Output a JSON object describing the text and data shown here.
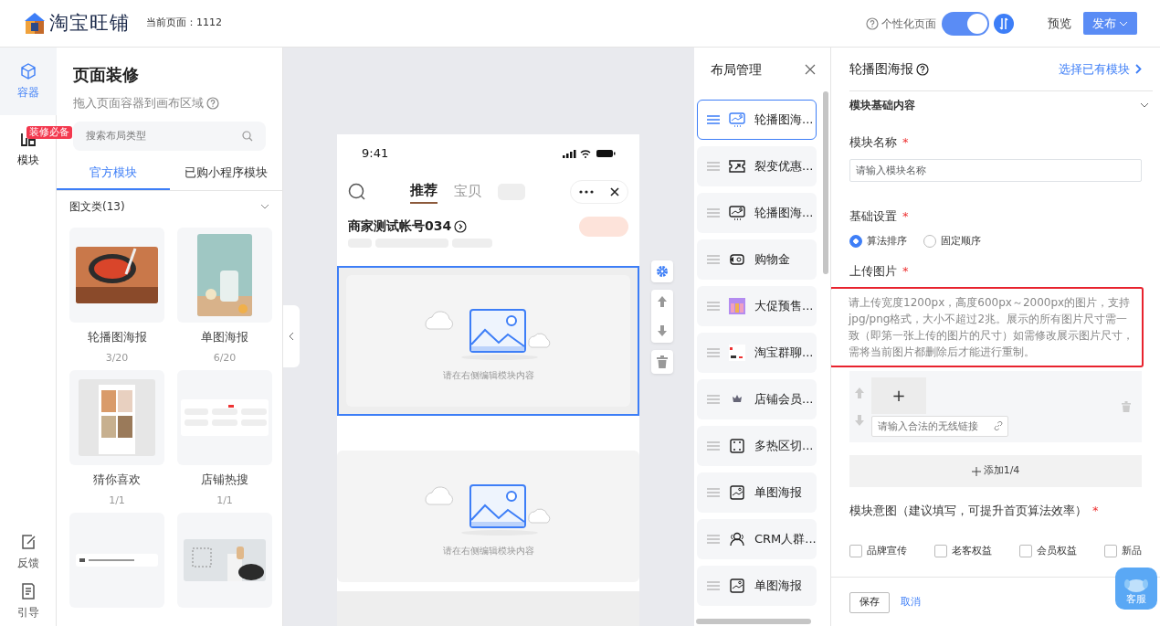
{
  "header": {
    "logo_text": "淘宝旺铺",
    "current_page": "当前页面：1112",
    "personalize_label": "个性化页面",
    "personalize_on": true,
    "preview": "预览",
    "publish": "发布"
  },
  "rail": [
    {
      "label": "容器",
      "kind": "cube",
      "selected": true
    },
    {
      "label": "模块",
      "kind": "blocks",
      "selected": false,
      "badge": "装修必备"
    }
  ],
  "rail_bottom": [
    {
      "label": "反馈",
      "kind": "edit"
    },
    {
      "label": "引导",
      "kind": "doc"
    }
  ],
  "sidebar": {
    "title": "页面装修",
    "subtitle": "拖入页面容器到画布区域",
    "search_placeholder": "搜索布局类型",
    "tabs": [
      {
        "label": "官方模块",
        "selected": true
      },
      {
        "label": "已购小程序模块",
        "selected": false
      }
    ],
    "category": {
      "label": "图文类(13)",
      "expanded": true
    },
    "modules": [
      {
        "kind": "picture",
        "name": "轮播图海报",
        "count": "3/20"
      },
      {
        "kind": "picture",
        "name": "单图海报",
        "count": "6/20"
      },
      {
        "kind": "picture",
        "name": "猜你喜欢",
        "count": "1/1"
      },
      {
        "kind": "picture",
        "name": "店铺热搜",
        "count": "1/1"
      },
      {
        "kind": "picture"
      },
      {
        "kind": "picture"
      }
    ]
  },
  "phone": {
    "time": "9:41",
    "tabs": [
      {
        "label": "推荐",
        "selected": true
      },
      {
        "label": "宝贝",
        "selected": false
      }
    ],
    "shop_name": "商家测试帐号034",
    "blocks": [
      {
        "text": "请在右侧编辑模块内容",
        "selected": true
      },
      {
        "text": "请在右侧编辑模块内容",
        "selected": false
      }
    ]
  },
  "layout_panel": {
    "title": "布局管理",
    "items": [
      {
        "label": "轮播图海...",
        "kind": "carousel",
        "selected": true
      },
      {
        "label": "裂变优惠...",
        "kind": "ticket",
        "selected": false
      },
      {
        "label": "轮播图海...",
        "kind": "carousel",
        "selected": false
      },
      {
        "label": "购物金",
        "kind": "money",
        "selected": false
      },
      {
        "label": "大促预售...",
        "kind": "thumb",
        "selected": false
      },
      {
        "label": "淘宝群聊...",
        "kind": "thumb2",
        "selected": false
      },
      {
        "label": "店铺会员...",
        "kind": "crown",
        "selected": false
      },
      {
        "label": "多热区切...",
        "kind": "hotzone",
        "selected": false
      },
      {
        "label": "单图海报",
        "kind": "poster",
        "selected": false
      },
      {
        "label": "CRM人群...",
        "kind": "people",
        "selected": false
      },
      {
        "label": "单图海报",
        "kind": "poster",
        "selected": false
      }
    ]
  },
  "editor": {
    "title": "轮播图海报",
    "choose_link": "选择已有模块",
    "section": {
      "label": "模块基础内容",
      "expanded": true
    },
    "name_field": {
      "label": "模块名称",
      "mark": "*",
      "placeholder": "请输入模块名称"
    },
    "basic_settings": {
      "label": "基础设置",
      "mark": "*",
      "options": [
        {
          "label": "算法排序",
          "selected": true
        },
        {
          "label": "固定顺序",
          "selected": false
        }
      ]
    },
    "upload": {
      "label": "上传图片",
      "mark": "*",
      "hint": "请上传宽度1200px，高度600px～2000px的图片，支持jpg/png格式，大小不超过2兆。展示的所有图片尺寸需一致（即第一张上传的图片的尺寸）如需修改展示图片尺寸，需将当前图片都删除后才能进行重制。",
      "hint_highlighted": true,
      "add_sign": "+",
      "link_placeholder": "请输入合法的无线链接"
    },
    "add_button": "添加1/4",
    "intent": {
      "label": "模块意图（建议填写，可提升首页算法效率）",
      "mark": "*",
      "options": [
        {
          "label": "品牌宣传",
          "checked": false
        },
        {
          "label": "老客权益",
          "checked": false
        },
        {
          "label": "会员权益",
          "checked": false
        },
        {
          "label": "新品",
          "checked": false
        }
      ]
    },
    "save": "保存",
    "cancel": "取消"
  },
  "support": "客服"
}
